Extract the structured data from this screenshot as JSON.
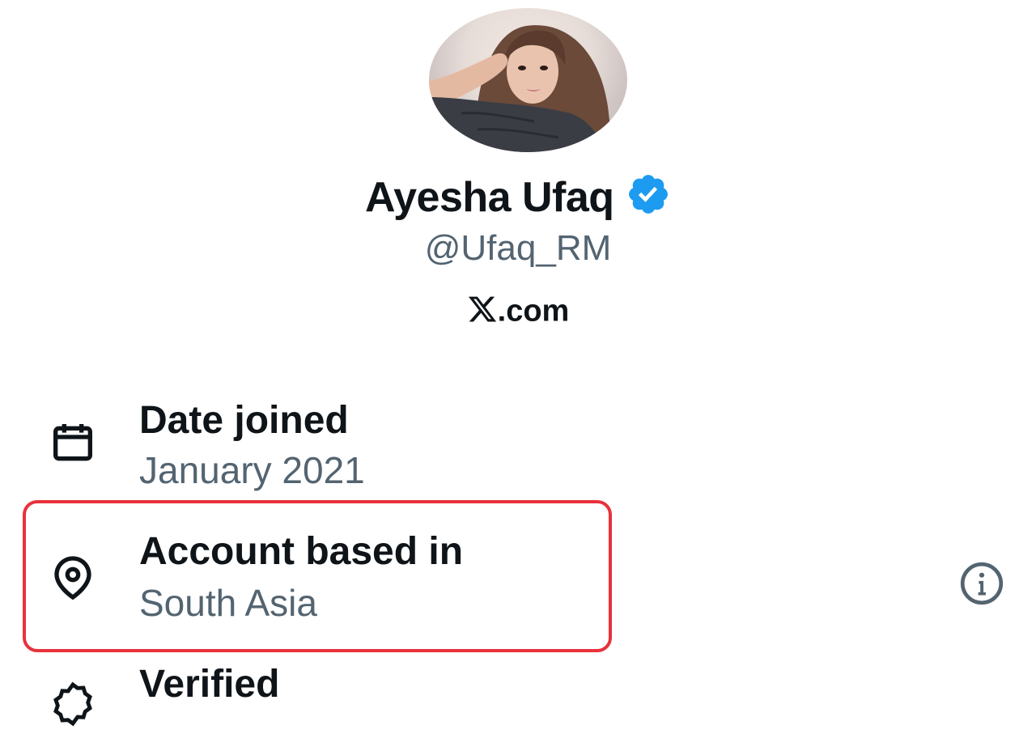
{
  "profile": {
    "display_name": "Ayesha Ufaq",
    "handle": "@Ufaq_RM",
    "verified": true,
    "badge_color": "#1d9bf0",
    "site": ".com"
  },
  "about": {
    "date_joined": {
      "icon": "calendar-icon",
      "title": "Date joined",
      "value": "January 2021"
    },
    "location": {
      "icon": "location-pin-icon",
      "title": "Account based in",
      "value": "South Asia",
      "highlight_color": "#e8323c",
      "info_icon": "info-icon"
    },
    "verified": {
      "icon": "verified-icon",
      "title": "Verified"
    }
  },
  "colors": {
    "primary_text": "#0f1419",
    "secondary_text": "#536471"
  }
}
